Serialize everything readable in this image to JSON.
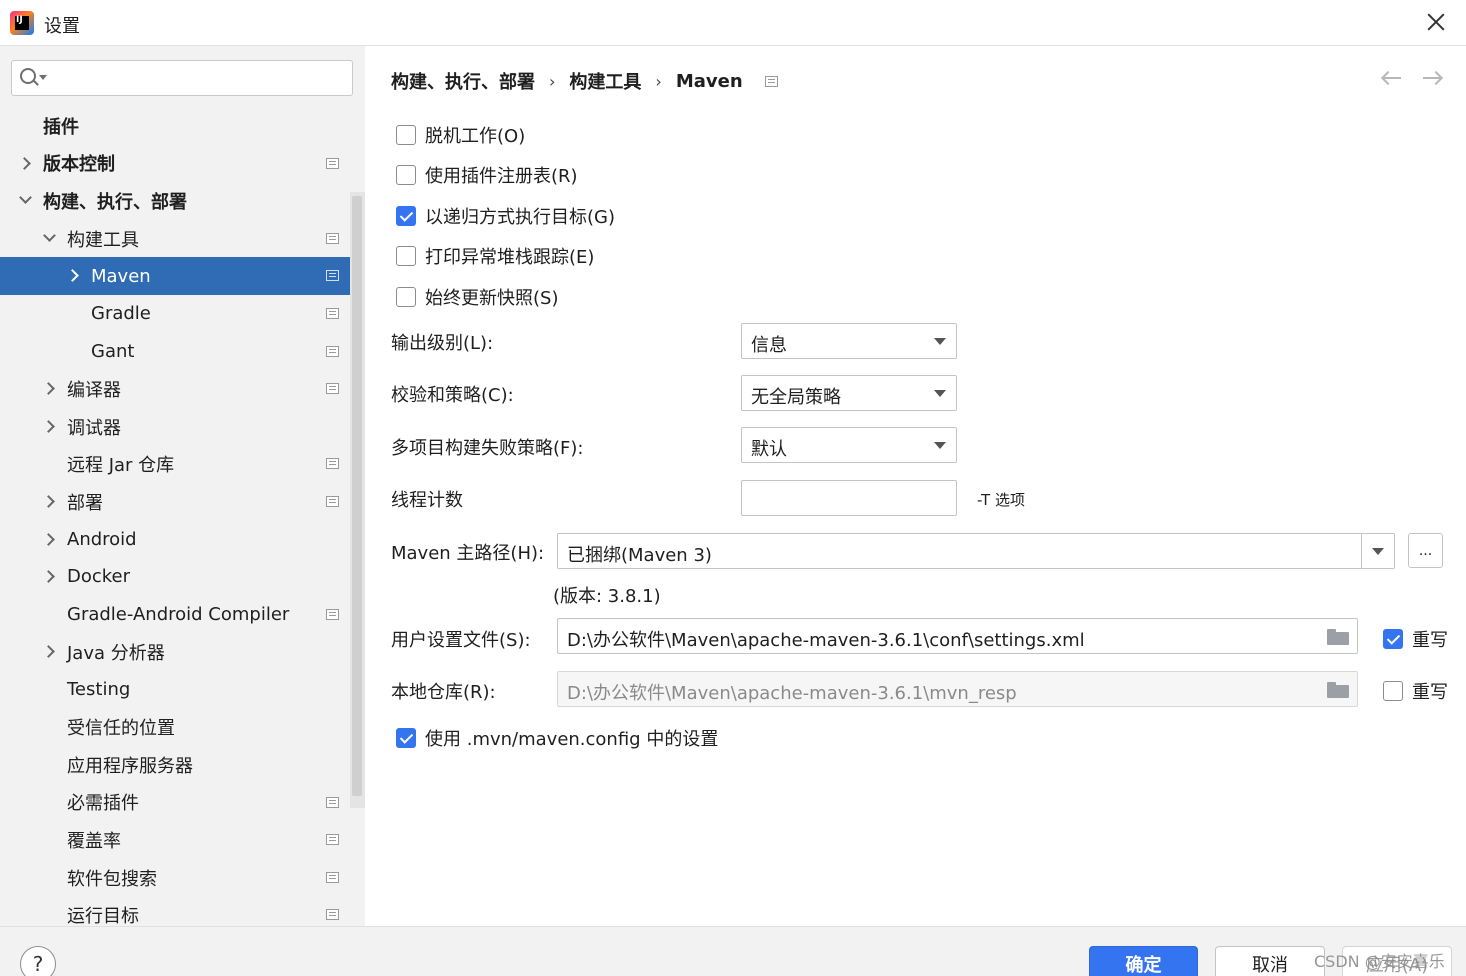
{
  "window": {
    "title": "设置"
  },
  "search": {
    "placeholder": "",
    "value": ""
  },
  "sidebar": {
    "items": [
      {
        "label": "插件",
        "bold": true,
        "level": 0,
        "arrow": "none",
        "icon": false
      },
      {
        "label": "版本控制",
        "bold": true,
        "level": 0,
        "arrow": "right",
        "icon": true
      },
      {
        "label": "构建、执行、部署",
        "bold": true,
        "level": 0,
        "arrow": "down",
        "icon": false
      },
      {
        "label": "构建工具",
        "bold": false,
        "level": 1,
        "arrow": "down",
        "icon": true
      },
      {
        "label": "Maven",
        "bold": false,
        "level": 2,
        "arrow": "right",
        "icon": true,
        "selected": true
      },
      {
        "label": "Gradle",
        "bold": false,
        "level": 2,
        "arrow": "none",
        "icon": true
      },
      {
        "label": "Gant",
        "bold": false,
        "level": 2,
        "arrow": "none",
        "icon": true
      },
      {
        "label": "编译器",
        "bold": false,
        "level": 1,
        "arrow": "right",
        "icon": true
      },
      {
        "label": "调试器",
        "bold": false,
        "level": 1,
        "arrow": "right",
        "icon": false
      },
      {
        "label": "远程 Jar 仓库",
        "bold": false,
        "level": 1,
        "arrow": "none",
        "icon": true
      },
      {
        "label": "部署",
        "bold": false,
        "level": 1,
        "arrow": "right",
        "icon": true
      },
      {
        "label": "Android",
        "bold": false,
        "level": 1,
        "arrow": "right",
        "icon": false
      },
      {
        "label": "Docker",
        "bold": false,
        "level": 1,
        "arrow": "right",
        "icon": false
      },
      {
        "label": "Gradle-Android Compiler",
        "bold": false,
        "level": 1,
        "arrow": "none",
        "icon": true
      },
      {
        "label": "Java 分析器",
        "bold": false,
        "level": 1,
        "arrow": "right",
        "icon": false
      },
      {
        "label": "Testing",
        "bold": false,
        "level": 1,
        "arrow": "none",
        "icon": false
      },
      {
        "label": "受信任的位置",
        "bold": false,
        "level": 1,
        "arrow": "none",
        "icon": false
      },
      {
        "label": "应用程序服务器",
        "bold": false,
        "level": 1,
        "arrow": "none",
        "icon": false
      },
      {
        "label": "必需插件",
        "bold": false,
        "level": 1,
        "arrow": "none",
        "icon": true
      },
      {
        "label": "覆盖率",
        "bold": false,
        "level": 1,
        "arrow": "none",
        "icon": true
      },
      {
        "label": "软件包搜索",
        "bold": false,
        "level": 1,
        "arrow": "none",
        "icon": true
      },
      {
        "label": "运行目标",
        "bold": false,
        "level": 1,
        "arrow": "none",
        "icon": true
      }
    ]
  },
  "breadcrumb": {
    "part1": "构建、执行、部署",
    "part2": "构建工具",
    "part3": "Maven",
    "sep": "›"
  },
  "options": {
    "offline": {
      "label": "脱机工作(O)",
      "checked": false
    },
    "plugin_registry": {
      "label": "使用插件注册表(R)",
      "checked": false
    },
    "recursive": {
      "label": "以递归方式执行目标(G)",
      "checked": true
    },
    "print_stack": {
      "label": "打印异常堆栈跟踪(E)",
      "checked": false
    },
    "always_update": {
      "label": "始终更新快照(S)",
      "checked": false
    },
    "use_mvn_config": {
      "label": "使用 .mvn/maven.config 中的设置",
      "checked": true
    }
  },
  "fields": {
    "output_level": {
      "label": "输出级别(L):",
      "value": "信息"
    },
    "checksum_policy": {
      "label": "校验和策略(C):",
      "value": "无全局策略"
    },
    "fail_policy": {
      "label": "多项目构建失败策略(F):",
      "value": "默认"
    },
    "thread_count": {
      "label": "线程计数",
      "value": "",
      "hint": "-T 选项"
    },
    "maven_home": {
      "label": "Maven 主路径(H):",
      "value": "已捆绑(Maven 3)",
      "browse": "..."
    },
    "version": {
      "text": "(版本: 3.8.1)"
    },
    "user_settings": {
      "label": "用户设置文件(S):",
      "value": "D:\\办公软件\\Maven\\apache-maven-3.6.1\\conf\\settings.xml",
      "override_label": "重写",
      "override_checked": true
    },
    "local_repo": {
      "label": "本地仓库(R):",
      "value": "D:\\办公软件\\Maven\\apache-maven-3.6.1\\mvn_resp",
      "override_label": "重写",
      "override_checked": false
    }
  },
  "footer": {
    "help": "?",
    "ok": "确定",
    "cancel": "取消",
    "apply": "应用(A)",
    "watermark": "CSDN @安安喜乐"
  }
}
